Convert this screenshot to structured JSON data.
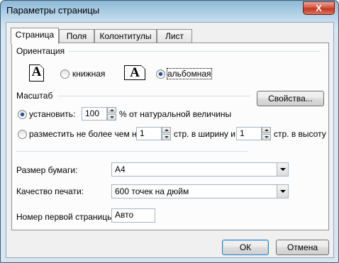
{
  "window": {
    "title": "Параметры страницы",
    "close_symbol": "X"
  },
  "tabs": [
    "Страница",
    "Поля",
    "Колонтитулы",
    "Лист"
  ],
  "orientation": {
    "label": "Ориентация",
    "portrait_icon": "A",
    "portrait_label": "книжная",
    "landscape_icon": "A",
    "landscape_label": "альбомная",
    "selected": "landscape"
  },
  "scale": {
    "label": "Масштаб",
    "properties_button": "Свойства...",
    "adjust_label": "установить:",
    "adjust_value": "100",
    "adjust_suffix": "% от натуральной величины",
    "fit_label": "разместить не более чем на:",
    "fit_wide_value": "1",
    "fit_wide_suffix": "стр. в ширину и",
    "fit_tall_value": "1",
    "fit_tall_suffix": "стр. в высоту",
    "selected": "adjust"
  },
  "paper_size": {
    "label": "Размер бумаги:",
    "value": "А4"
  },
  "print_quality": {
    "label": "Качество печати:",
    "value": "600 точек на дюйм"
  },
  "first_page_number": {
    "label": "Номер первой страницы:",
    "value": "Авто"
  },
  "buttons": {
    "ok": "ОК",
    "cancel": "Отмена"
  }
}
